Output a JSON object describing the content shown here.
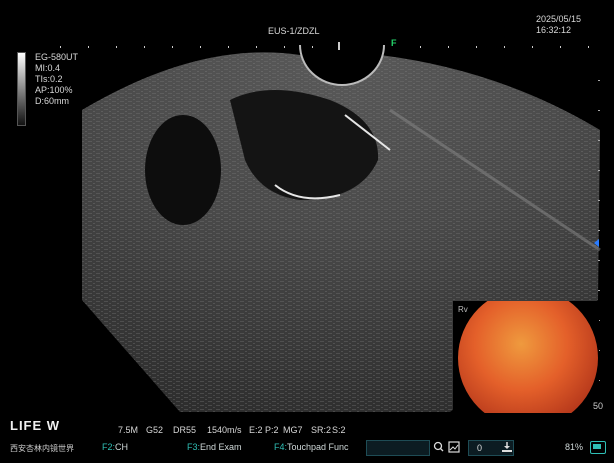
{
  "header": {
    "center_title": "EUS-1/ZDZL",
    "date": "2025/05/15",
    "time": "16:32:12",
    "focus_marker": "F"
  },
  "params": {
    "probe": "EG-580UT",
    "mi": "MI:0.4",
    "tis": "TIs:0.2",
    "ap": "AP:100%",
    "depth": "D:60mm"
  },
  "status_line": {
    "frequency": "7.5M",
    "gain": "G52",
    "dr": "DR55",
    "speed": "1540m/s",
    "e": "E:2",
    "p": "P:2",
    "mg": "MG7",
    "sr": "SR:2",
    "s": "S:2"
  },
  "function_keys": [
    {
      "key": "F2:",
      "label": "CH"
    },
    {
      "key": "F3:",
      "label": "End Exam"
    },
    {
      "key": "F4:",
      "label": "Touchpad Func"
    }
  ],
  "counter": "0",
  "battery": "81%",
  "depth_marker_bottom": "50",
  "endoscope_label": "Rv",
  "watermark_text": "LIFE W",
  "watermark_sub": "西安杏林内镜世界",
  "colors": {
    "accent": "#2fbfb6",
    "focus_marker": "#23d36a",
    "depth_marker": "#2a7cff"
  }
}
